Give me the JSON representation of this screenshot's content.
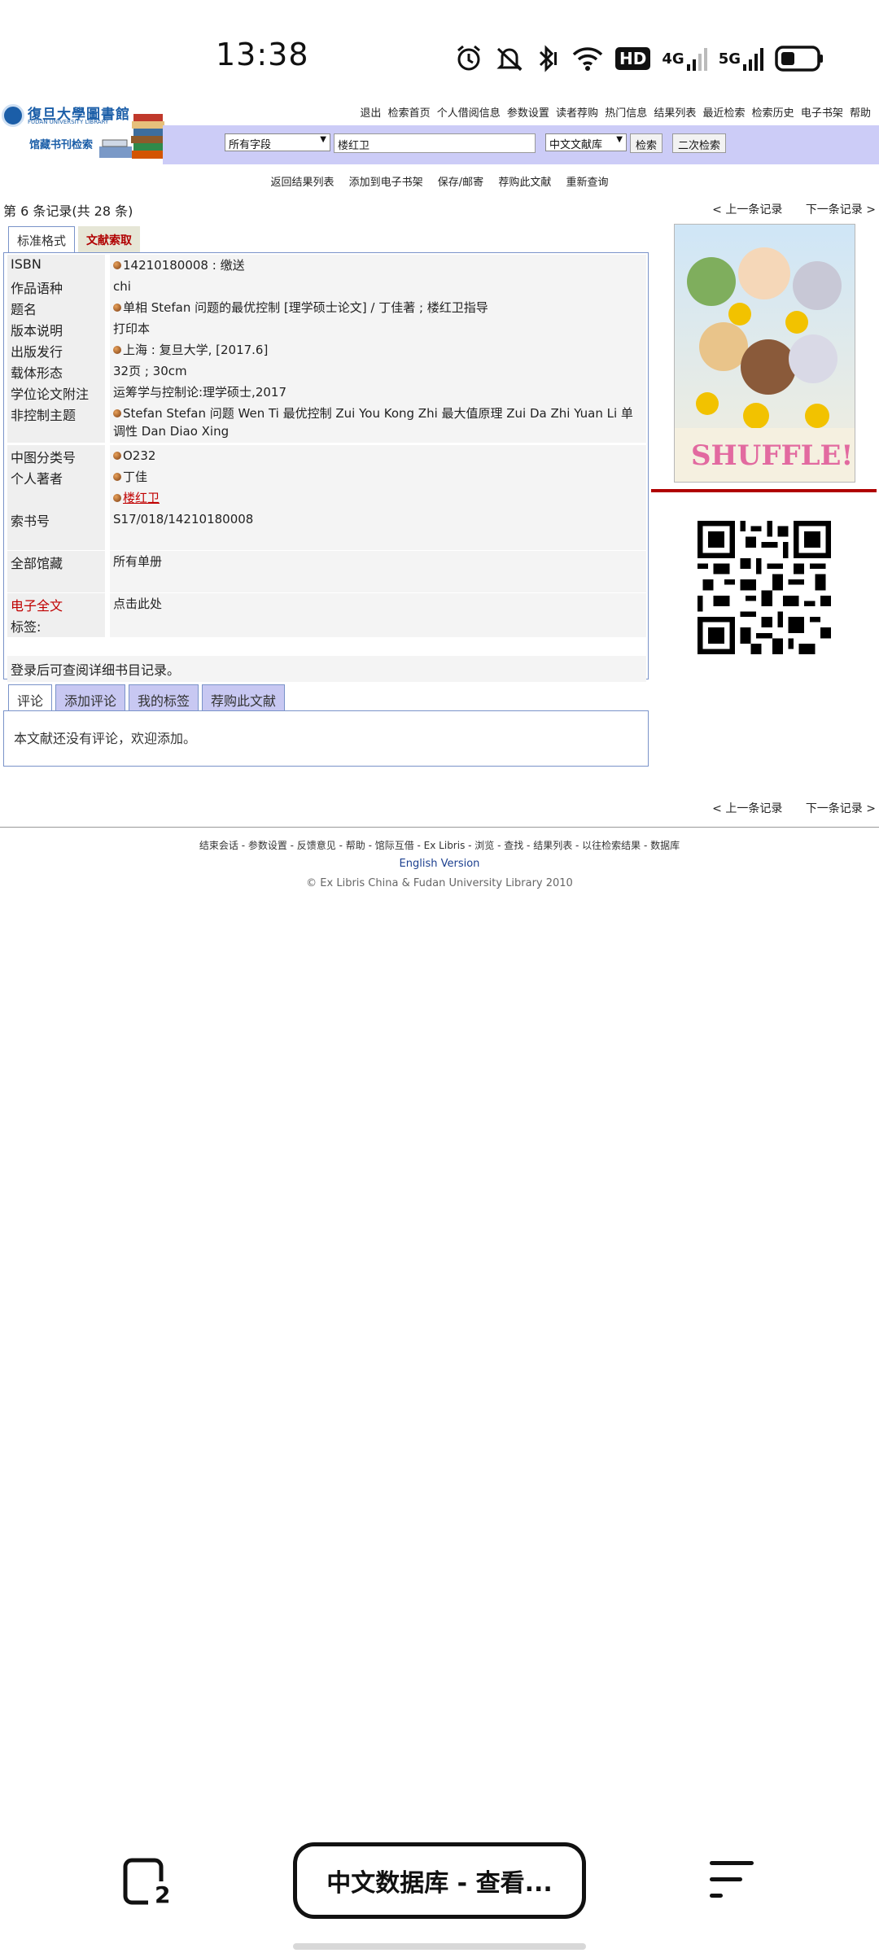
{
  "status": {
    "time": "13:38",
    "hd_label": "HD",
    "sim1_label": "4G",
    "sim2_label": "5G"
  },
  "header": {
    "logo_cn": "復旦大學圖書館",
    "logo_en": "FUDAN UNIVERSITY LIBRARY",
    "logo_sub": "馆藏书刊检索",
    "links": [
      "退出",
      "检索首页",
      "个人借阅信息",
      "参数设置",
      "读者荐购",
      "热门信息",
      "结果列表",
      "最近检索",
      "检索历史",
      "电子书架",
      "帮助"
    ]
  },
  "search": {
    "field_select": "所有字段",
    "query": "楼红卫",
    "db_select": "中文文献库",
    "search_btn": "检索",
    "second_search_btn": "二次检索"
  },
  "actions": [
    "返回结果列表",
    "添加到电子书架",
    "保存/邮寄",
    "荐购此文献",
    "重新查询"
  ],
  "record_nav": {
    "count": "第 6 条记录(共 28 条)",
    "prev": "< 上一条记录",
    "next": "下一条记录 >"
  },
  "tabs": {
    "standard": "标准格式",
    "catalog": "文献索取"
  },
  "record": [
    {
      "label": "ISBN",
      "value": "14210180008 : 缴送",
      "bullet": true
    },
    {
      "label": "作品语种",
      "value": "chi",
      "bullet": false
    },
    {
      "label": "题名",
      "value": "单相 Stefan 问题的最优控制 [理学硕士论文]  / 丁佳著 ; 楼红卫指导",
      "bullet": true
    },
    {
      "label": "版本说明",
      "value": "打印本",
      "bullet": false
    },
    {
      "label": "出版发行",
      "value": "上海 : 复旦大学, [2017.6]",
      "bullet": true
    },
    {
      "label": "载体形态",
      "value": "32页 ; 30cm",
      "bullet": false
    },
    {
      "label": "学位论文附注",
      "value": "运筹学与控制论:理学硕士,2017",
      "bullet": false
    },
    {
      "label": "非控制主题",
      "value": "Stefan Stefan 问题 Wen Ti 最优控制 Zui You Kong Zhi 最大值原理 Zui Da Zhi Yuan Li 单调性 Dan Diao Xing",
      "bullet": true
    },
    {
      "label": "中图分类号",
      "value": "O232",
      "bullet": true
    },
    {
      "label": "个人著者",
      "value": "丁佳",
      "bullet": true
    },
    {
      "label": "",
      "value": "楼红卫",
      "bullet": true
    },
    {
      "label": "索书号",
      "value": "S17/018/14210180008",
      "bullet": false
    },
    {
      "label": "",
      "value": "",
      "bullet": false
    },
    {
      "label": "全部馆藏",
      "value": "所有单册",
      "bullet": false
    },
    {
      "label": "",
      "value": "",
      "bullet": false
    },
    {
      "label": "电子全文",
      "value": "点击此处",
      "bullet": false
    },
    {
      "label": "标签:",
      "value": "",
      "bullet": false
    }
  ],
  "login_note": "登录后可查阅详细书目记录。",
  "comment_tabs": [
    "评论",
    "添加评论",
    "我的标签",
    "荐购此文献"
  ],
  "comment_text": "本文献还没有评论，欢迎添加。",
  "footer": {
    "links": "结束会话 - 参数设置 - 反馈意见 - 帮助 - 馆际互借 - Ex Libris - 浏览 - 查找 - 结果列表 - 以往检索结果 - 数据库",
    "english": "English Version",
    "copyright": "© Ex Libris China & Fudan University Library 2010"
  },
  "bottom_nav": {
    "tab_count": "2",
    "title": "中文数据库 - 查看..."
  },
  "colors": {
    "accent": "#1b5ea8",
    "search_bar": "#ccccf7",
    "tab_border": "#7a93c9",
    "highlight_red": "#c00000"
  }
}
